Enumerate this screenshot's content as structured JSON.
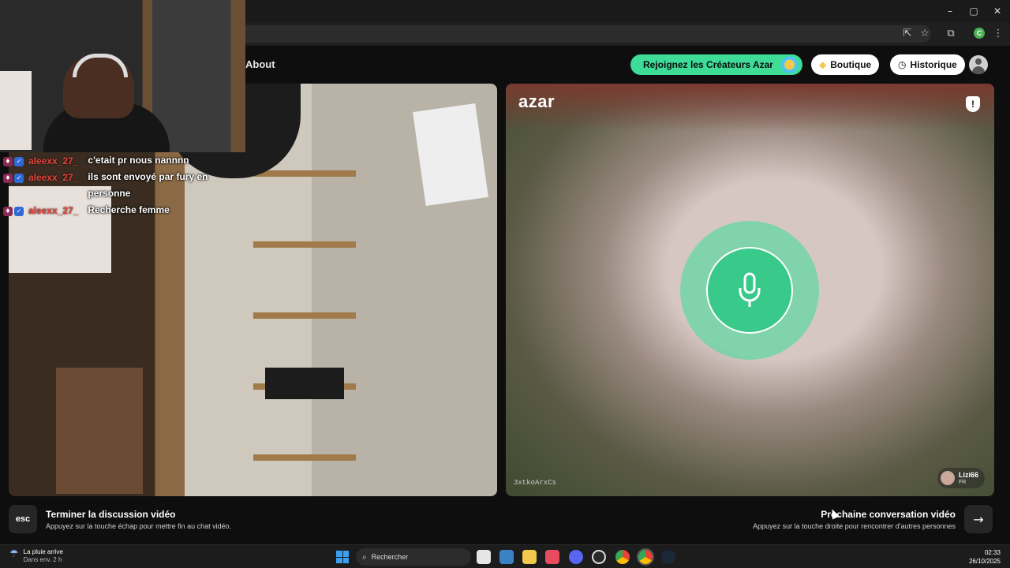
{
  "window_controls": {
    "minimize": "–",
    "maximize": "▢",
    "close": "✕"
  },
  "toolbar_icons": [
    "install-icon",
    "star-icon",
    "extensions-icon",
    "profile-icon",
    "menu-icon"
  ],
  "profile_initial": "C",
  "nav": {
    "about": "About"
  },
  "header": {
    "creators_label": "Rejoignez les Créateurs Azar",
    "shop_label": "Boutique",
    "shop_icon": "◆",
    "history_label": "Historique",
    "history_icon": "◷"
  },
  "remote_video": {
    "logo": "azar",
    "shield_glyph": "!",
    "user_id": "3xtkoArxCs",
    "partner_name": "Lizi66",
    "partner_country": "FR"
  },
  "footer": {
    "esc_key": "esc",
    "end_title": "Terminer la discussion vidéo",
    "end_sub": "Appuyez sur la touche échap pour mettre fin au chat vidéo.",
    "next_title": "Prochaine conversation vidéo",
    "next_sub": "Appuyez sur la touche droite pour rencontrer d'autres personnes",
    "next_key": "→"
  },
  "chat": [
    {
      "user": "aleexx_27_",
      "message": "c'etait pr nous nannnn"
    },
    {
      "user": "aleexx_27_",
      "message": "ils sont envoyé par fury en personne"
    },
    {
      "user": "aleexx_27_",
      "message": "Recherche femme"
    }
  ],
  "taskbar": {
    "weather_line1": "La pluie arrive",
    "weather_line2": "Dans env. 2 h",
    "search_placeholder": "Rechercher",
    "time": "02:33",
    "date": "26/10/2025"
  },
  "colors": {
    "accent": "#3ddc97",
    "chat_user": "#e8453c"
  }
}
